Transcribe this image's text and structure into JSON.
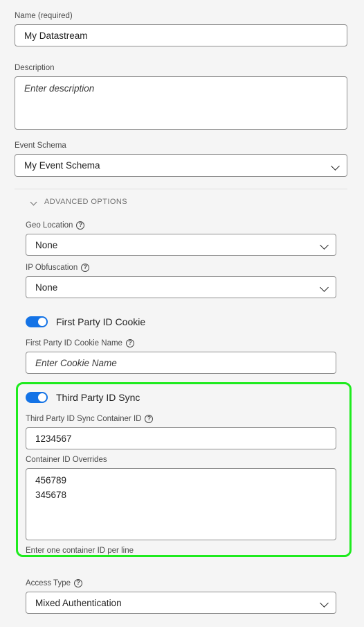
{
  "form": {
    "name_field": {
      "label": "Name (required)",
      "value": "My Datastream"
    },
    "description_field": {
      "label": "Description",
      "placeholder": "Enter description",
      "value": ""
    },
    "event_schema_field": {
      "label": "Event Schema",
      "value": "My Event Schema",
      "chevron_icon": "chevron-down-icon"
    },
    "advanced_options": {
      "label": "ADVANCED OPTIONS",
      "chevron_icon": "chevron-down-icon",
      "geo_location": {
        "label": "Geo Location",
        "help_icon": "help-circle-icon",
        "value": "None"
      },
      "ip_obfuscation": {
        "label": "IP Obfuscation",
        "help_icon": "help-circle-icon",
        "value": "None"
      },
      "first_party_id_cookie": {
        "toggle_label": "First Party ID Cookie",
        "toggle_state": "on",
        "cookie_name": {
          "label": "First Party ID Cookie Name",
          "help_icon": "help-circle-icon",
          "placeholder": "Enter Cookie Name",
          "value": ""
        }
      },
      "third_party_id_sync": {
        "toggle_label": "Third Party ID Sync",
        "toggle_state": "on",
        "highlighted": true,
        "highlight_color": "#1eeb1e",
        "container_id": {
          "label": "Third Party ID Sync Container ID",
          "help_icon": "help-circle-icon",
          "value": "1234567"
        },
        "container_id_overrides": {
          "label": "Container ID Overrides",
          "value": "456789\n345678",
          "helper_text": "Enter one container ID per line"
        }
      },
      "access_type": {
        "label": "Access Type",
        "help_icon": "help-circle-icon",
        "value": "Mixed Authentication"
      }
    }
  },
  "colors": {
    "toggle_on": "#1473e6",
    "highlight": "#1eeb1e",
    "page_background": "#f5f5f5"
  }
}
